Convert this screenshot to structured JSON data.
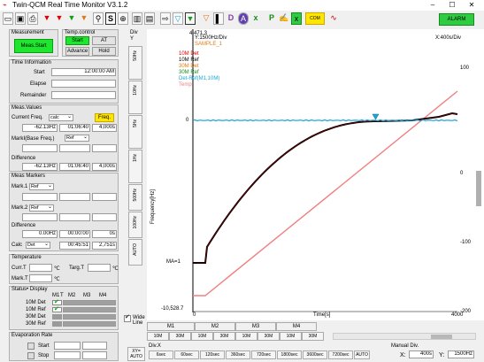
{
  "window": {
    "title": "Twin-QCM Real Time Monitor V3.1.2"
  },
  "toolbar": {
    "icons": [
      "open-icon",
      "save-icon",
      "print-icon",
      "marker-red-icon",
      "marker-red-icon",
      "marker-green-icon",
      "marker-orange-icon",
      "search-icon",
      "s-icon",
      "zoom-icon",
      "chart-icon",
      "view-icon",
      "arrow-right-icon",
      "triangle-cyan-icon",
      "triangle-green-icon",
      "triangle-orange-icon",
      "bar-icon",
      "d-icon",
      "a-icon",
      "excel-icon",
      "p-icon",
      "color-icon",
      "axis-icon",
      "com-icon",
      "graph-icon"
    ],
    "toggled": [
      "s-icon",
      "triangle-cyan-icon",
      "axis-icon"
    ],
    "alarm_label": "ALARM",
    "com_label": "COM"
  },
  "measurement": {
    "title": "Measurement",
    "start_label": "Meas.Start"
  },
  "temp_control": {
    "title": "Temp.control",
    "start": "Start",
    "at": "AT",
    "advance": "Advance",
    "hold": "Hold"
  },
  "time_info": {
    "title": "Time Information",
    "start_label": "Start",
    "start_value": "12:00:00 AM",
    "elapse_label": "Elapse",
    "elapse_value": "",
    "remainder_label": "Remainder",
    "remainder_value": ""
  },
  "meas_values": {
    "title": "Meas.Values",
    "current_freq_label": "Current Freq.",
    "calc": "calc",
    "freq_button": "Freq.",
    "freq": "-62.13Hz",
    "time1": "01:06:40",
    "time2": "4,000s",
    "mark_base_label": "MarkⅠ(Base Freq.)",
    "mark_base_sel": "Ref",
    "base_value": "",
    "difference_label": "Difference",
    "diff_freq": "-62.13Hz",
    "diff_time1": "01:06:40",
    "diff_time2": "4,000s"
  },
  "meas_markers": {
    "title": "Meas Markers",
    "mark1_label": "Mark.1",
    "mark1_sel": "Ref",
    "mark2_label": "Mark.2",
    "mark2_sel": "Ref",
    "mark2_freq": "",
    "mark2_time": "00:00:00",
    "mark2_s": "0s",
    "difference_label": "Difference",
    "diff_freq": "0.00Hz",
    "diff_time": "00:00:00",
    "diff_s": "0s",
    "calc_label": "Calc",
    "calc_sel": "Det",
    "calc_freq": "",
    "calc_time": "00:45:51",
    "calc_s": "2,751s"
  },
  "temperature": {
    "title": "Temperature",
    "curr_label": "Curr.T",
    "curr_unit": "℃",
    "targ_label": "Targ.T",
    "targ_unit": "℃",
    "mark_label": "Mark.T",
    "mark_unit": "℃"
  },
  "status_display": {
    "title": "Status• Display",
    "cols": [
      "M1",
      "T",
      "M2",
      "M3",
      "M4"
    ],
    "rows": [
      {
        "label": "10M Det",
        "m1": true
      },
      {
        "label": "10M Ref",
        "m1": true
      },
      {
        "label": "30M Det",
        "m1": false
      },
      {
        "label": "30M Ref",
        "m1": false
      }
    ]
  },
  "evaporation": {
    "title": "Evaporation Rate",
    "start_label": "Start",
    "stop_label": "Stop"
  },
  "div": {
    "title": "Div\nY",
    "buttons": [
      "50Hz",
      "10Hz",
      "5Hz",
      "1Hz",
      "500Hz",
      "100Hz",
      "AUTO"
    ]
  },
  "wide_line": {
    "label": "Wide\nLine"
  },
  "xy_auto": "XY=\nAUTO",
  "chart": {
    "ytop": "4,471.3",
    "ybot": "-10,528.7",
    "ylabel_div": "Y:1500Hz/Div",
    "xlabel_div": "X:400s/Div",
    "ylabel": "Frequency[Hz]",
    "xlabel": "Time[s]",
    "ma_label": "MA=1",
    "x_ticks": [
      "0",
      "4000"
    ],
    "zero_tick": "0",
    "right_ticks": [
      "100",
      "0",
      "-100",
      "-200"
    ],
    "legend": [
      {
        "name": "Y:1500Hz/Div",
        "color": "#000000"
      },
      {
        "name": "SAMPLE_1",
        "color": "#e07a18"
      },
      {
        "name": "10M Det",
        "color": "#e00000"
      },
      {
        "name": "10M Ref",
        "color": "#000000"
      },
      {
        "name": "30M Det",
        "color": "#e07a18"
      },
      {
        "name": "30M Ref",
        "color": "#1a8a1a"
      },
      {
        "name": "Det-Ref(M1,10M)",
        "color": "#1aa7d8"
      },
      {
        "name": "Temp",
        "color": "#f08080"
      }
    ]
  },
  "bottom_tabs": {
    "labels": [
      "M1",
      "M2",
      "M3",
      "M4"
    ],
    "subs": [
      "10M",
      "30M",
      "10M",
      "30M",
      "10M",
      "30M",
      "10M",
      "30M"
    ]
  },
  "div_x": {
    "label": "Div.X",
    "buttons": [
      "6sec",
      "60sec",
      "120sec",
      "360sec",
      "720sec",
      "1800sec",
      "3600sec",
      "7200sec",
      "AUTO"
    ]
  },
  "manual_div": {
    "title": "Manual Div.",
    "x_label": "X:",
    "x_value": "400s",
    "y_label": "Y:",
    "y_value": "1500Hz"
  }
}
